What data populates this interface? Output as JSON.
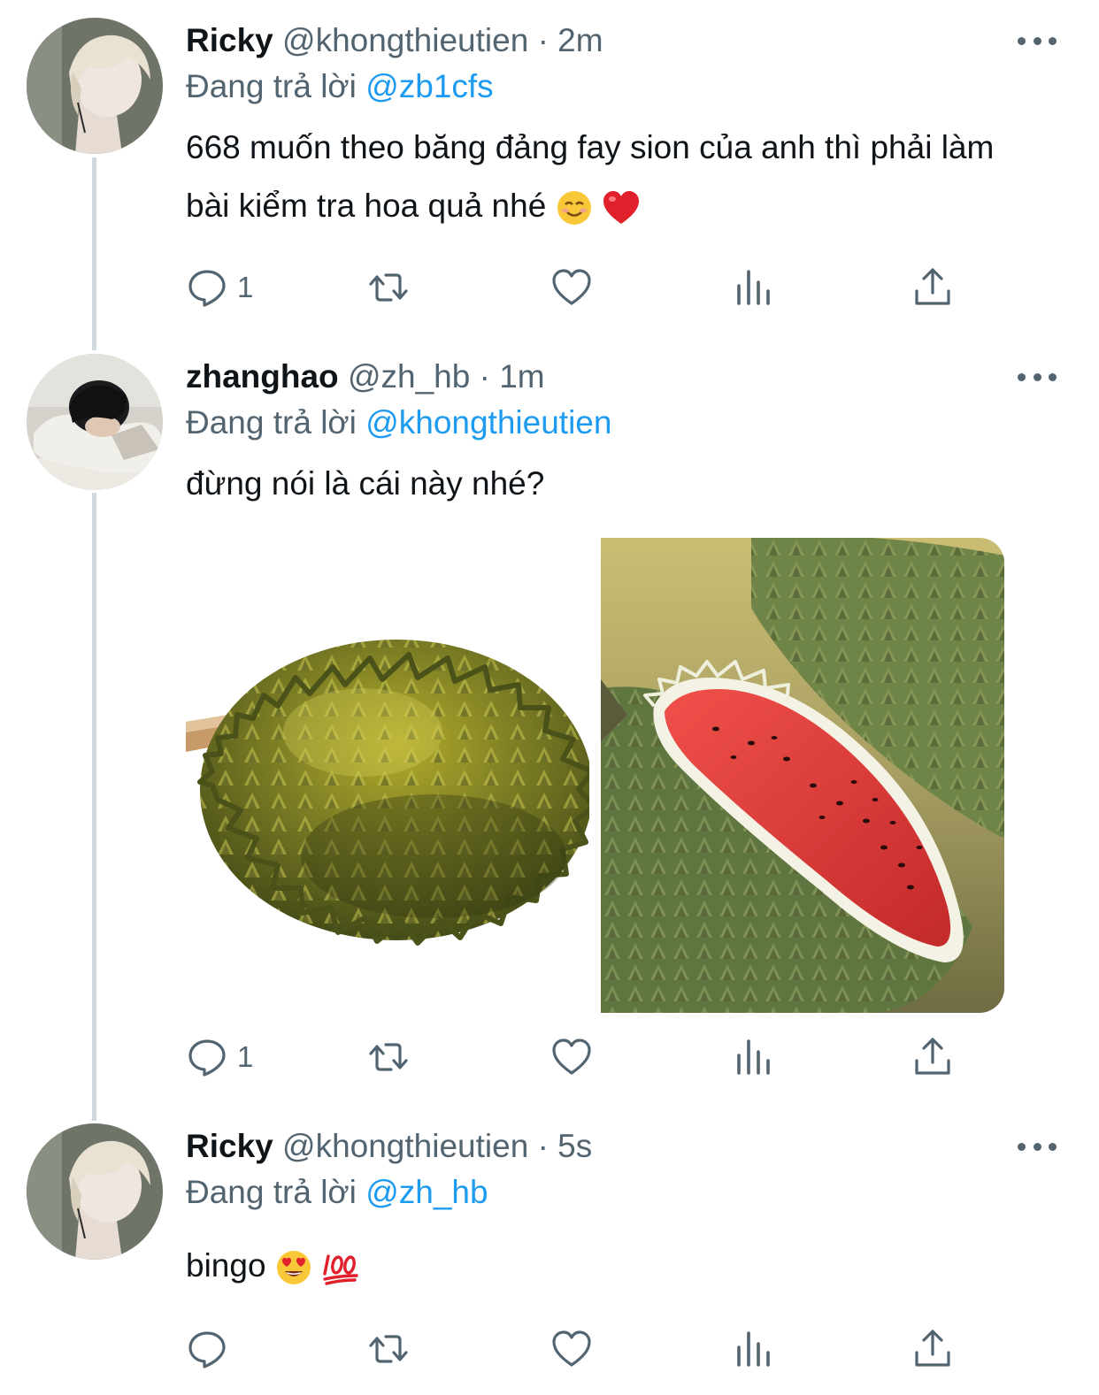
{
  "tweets": [
    {
      "name": "Ricky",
      "handle": "@khongthieutien",
      "dot": "·",
      "time": "2m",
      "reply_prefix": "Đang trả lời",
      "reply_to": "@zb1cfs",
      "text": "668 muốn theo băng đảng fay sion của anh thì phải làm bài kiểm tra hoa quả nhé",
      "reply_count": "1"
    },
    {
      "name": "zhanghao",
      "handle": "@zh_hb",
      "dot": "·",
      "time": "1m",
      "reply_prefix": "Đang trả lời",
      "reply_to": "@khongthieutien",
      "text": "đừng nói là cái này nhé?",
      "reply_count": "1"
    },
    {
      "name": "Ricky",
      "handle": "@khongthieutien",
      "dot": "·",
      "time": "5s",
      "reply_prefix": "Đang trả lời",
      "reply_to": "@zh_hb",
      "text": "bingo",
      "reply_count": ""
    }
  ],
  "icons": {
    "reply": "reply-icon",
    "retweet": "retweet-icon",
    "like": "heart-icon",
    "views": "analytics-icon",
    "share": "share-icon",
    "more": "more-icon"
  },
  "colors": {
    "text": "#0f1419",
    "muted": "#536471",
    "accent": "#1d9bf0",
    "thread_line": "#cfd9de"
  }
}
